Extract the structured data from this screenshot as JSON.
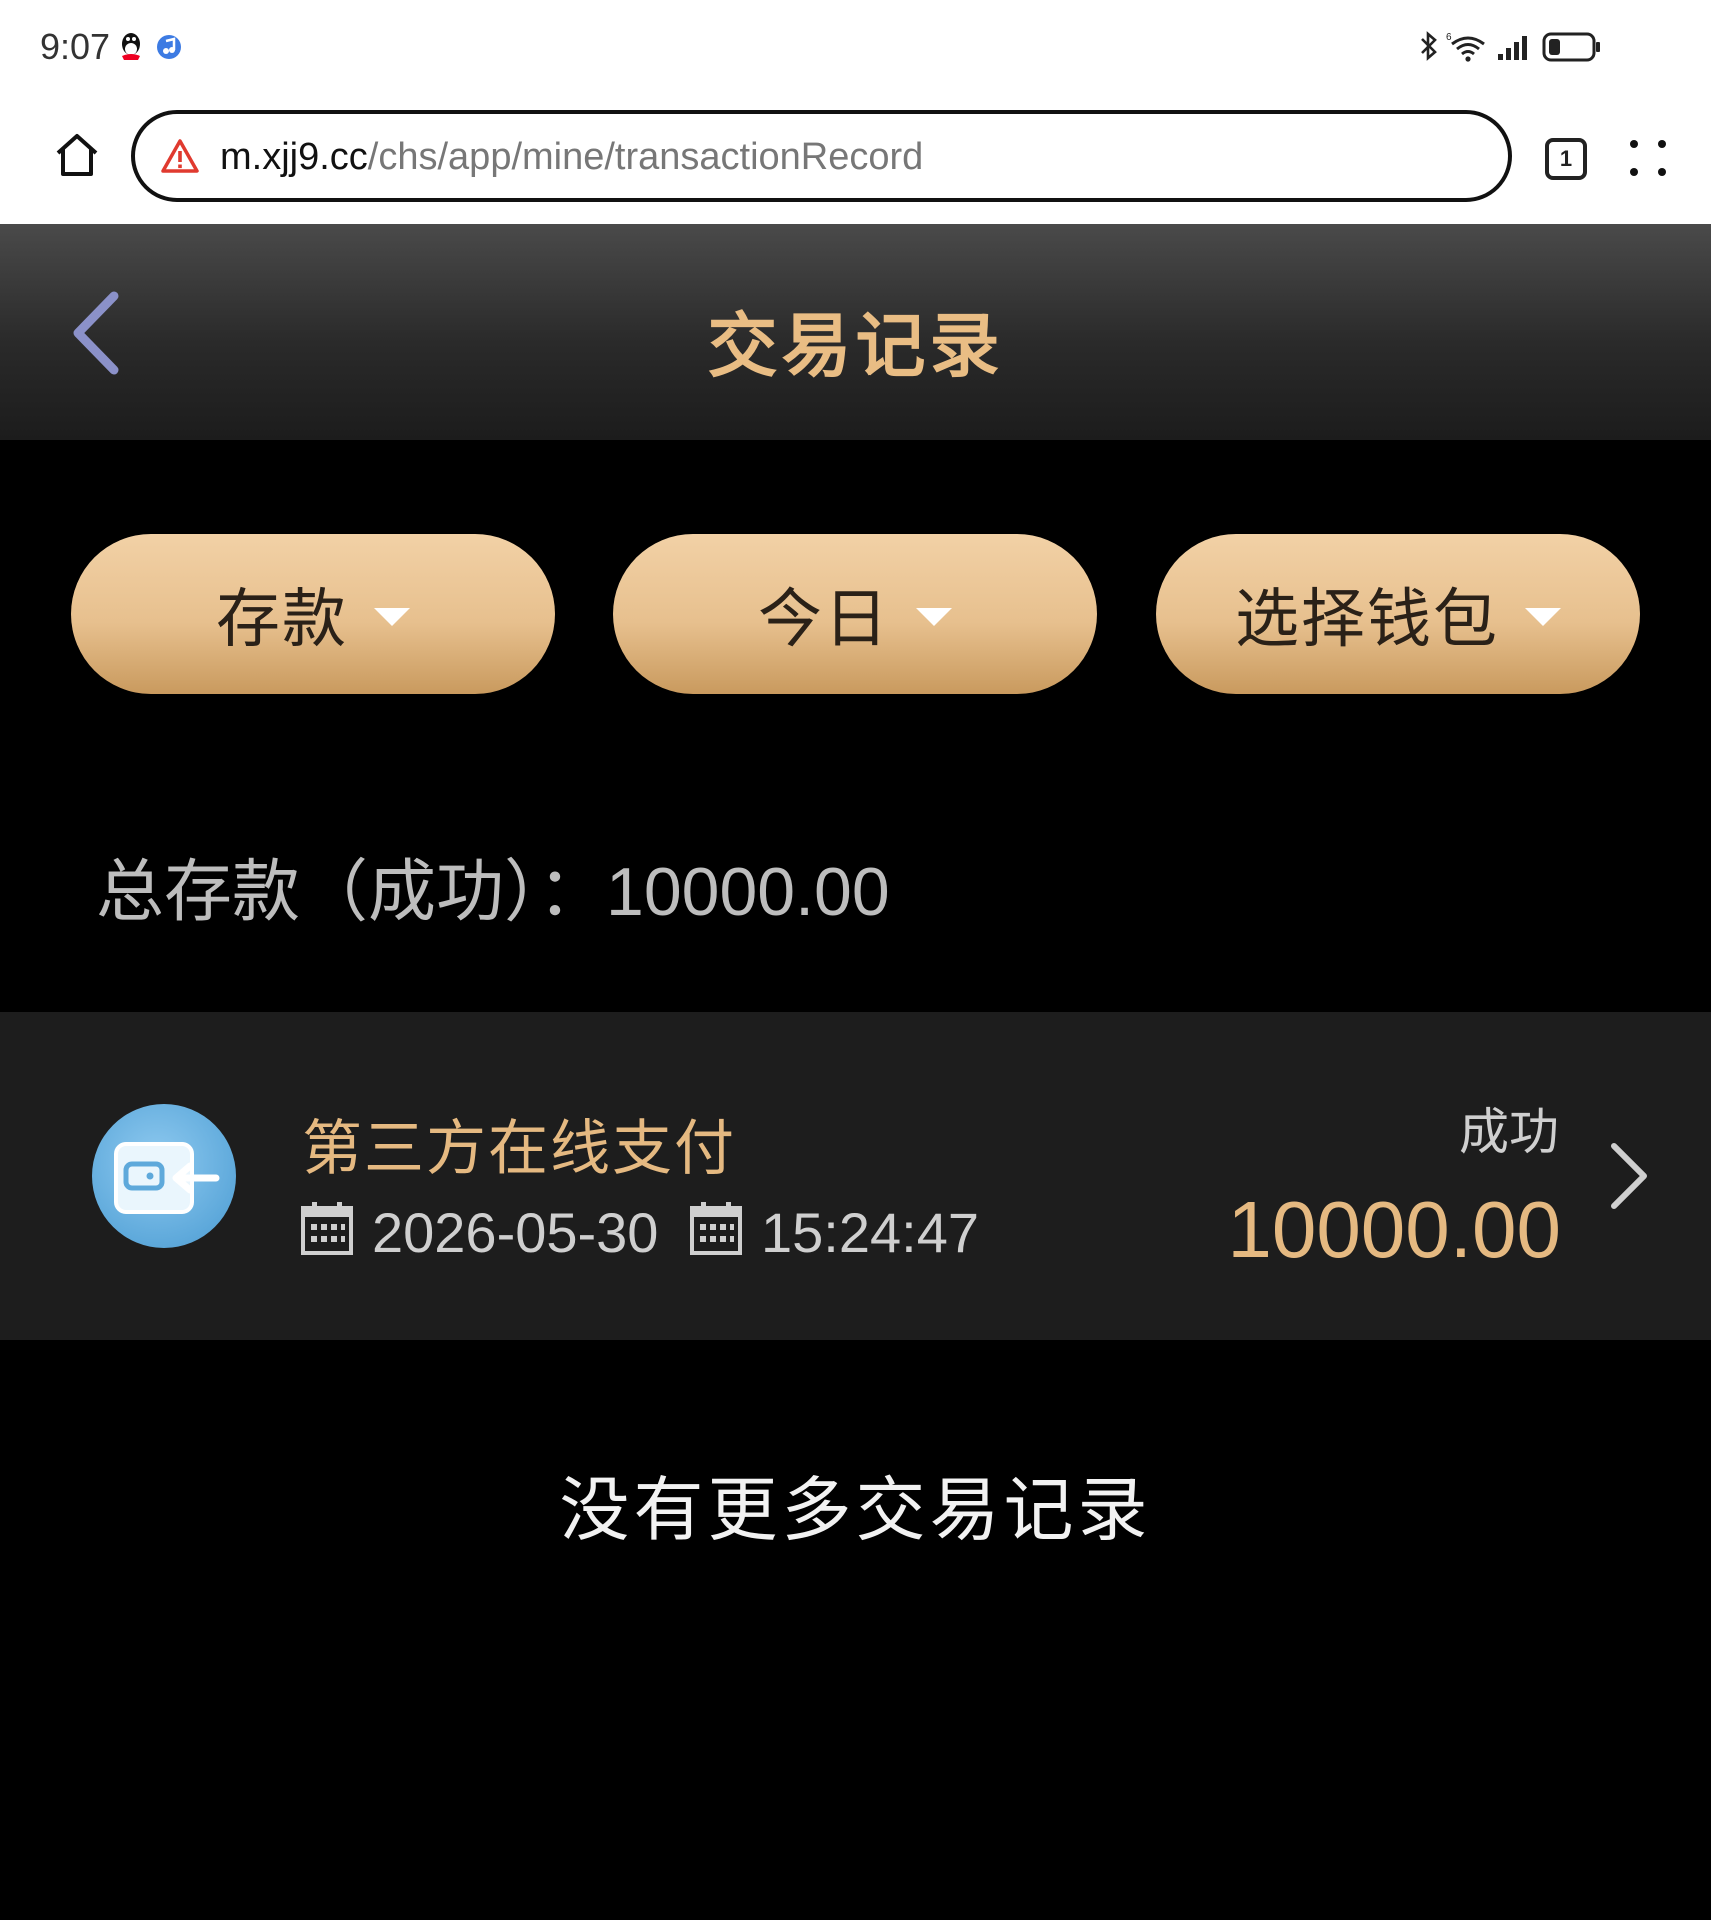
{
  "status_bar": {
    "time": "9:07",
    "icons": [
      "qq-icon",
      "music-icon",
      "bluetooth-icon",
      "wifi-icon",
      "signal-icon",
      "battery-icon"
    ]
  },
  "browser": {
    "url_host": "m.xjj9.cc",
    "url_path": "/chs/app/mine/transactionRecord",
    "tab_count": "1"
  },
  "header": {
    "title": "交易记录"
  },
  "filters": {
    "type": "存款",
    "date": "今日",
    "wallet": "选择钱包"
  },
  "summary": {
    "label": "总存款（成功）：",
    "value": "10000.00"
  },
  "records": [
    {
      "name": "第三方在线支付",
      "date": "2026-05-30",
      "time": "15:24:47",
      "status": "成功",
      "amount": "10000.00"
    }
  ],
  "footer": {
    "no_more": "没有更多交易记录"
  },
  "colors": {
    "gold": "#e9bd84",
    "background": "#000000",
    "card": "#1d1d1d",
    "avatar": "#5ea9db"
  }
}
